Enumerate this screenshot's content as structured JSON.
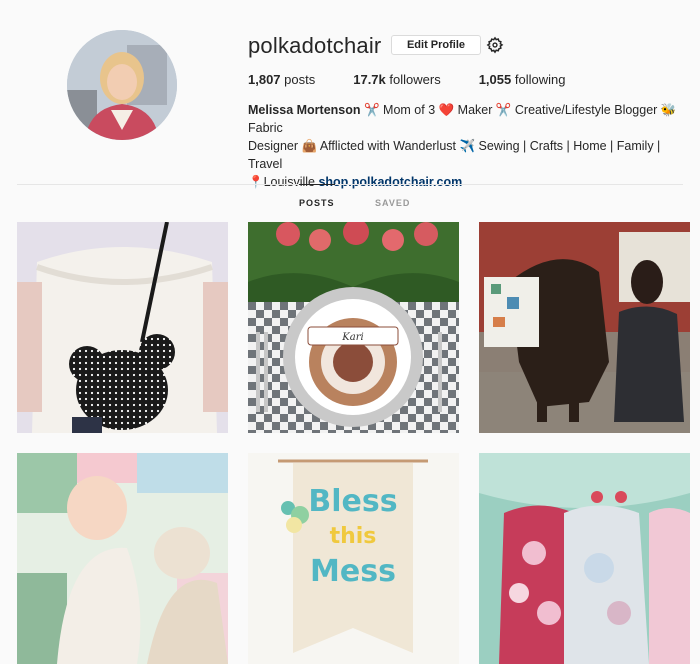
{
  "profile": {
    "username": "polkadotchair",
    "edit_label": "Edit Profile",
    "posts_count": "1,807",
    "posts_label": " posts",
    "followers_count": "17.7k",
    "followers_label": " followers",
    "following_count": "1,055",
    "following_label": " following",
    "bio_name": "Melissa Mortenson",
    "bio_line1": " ✂️ Mom of 3 ❤️ Maker ✂️ Creative/Lifestyle Blogger 🐝 Fabric",
    "bio_line2": "Designer 👜 Afflicted with Wanderlust ✈️ Sewing | Crafts | Home | Family | Travel",
    "bio_location": "📍Louisville ",
    "bio_link": "shop.polkadotchair.com"
  },
  "tabs": {
    "posts": "POSTS",
    "saved": "SAVED"
  },
  "posts": [
    {
      "alt": "mickey-bag",
      "banner": ""
    },
    {
      "alt": "thanksgiving-table",
      "banner": "Kari"
    },
    {
      "alt": "horse-quilt",
      "banner": ""
    },
    {
      "alt": "baby-quilt",
      "banner": ""
    },
    {
      "alt": "bless-this-mess",
      "banner": "Bless this Mess"
    },
    {
      "alt": "coin-purses",
      "banner": ""
    }
  ],
  "colors": {
    "link": "#003569",
    "accent": "#262626"
  }
}
